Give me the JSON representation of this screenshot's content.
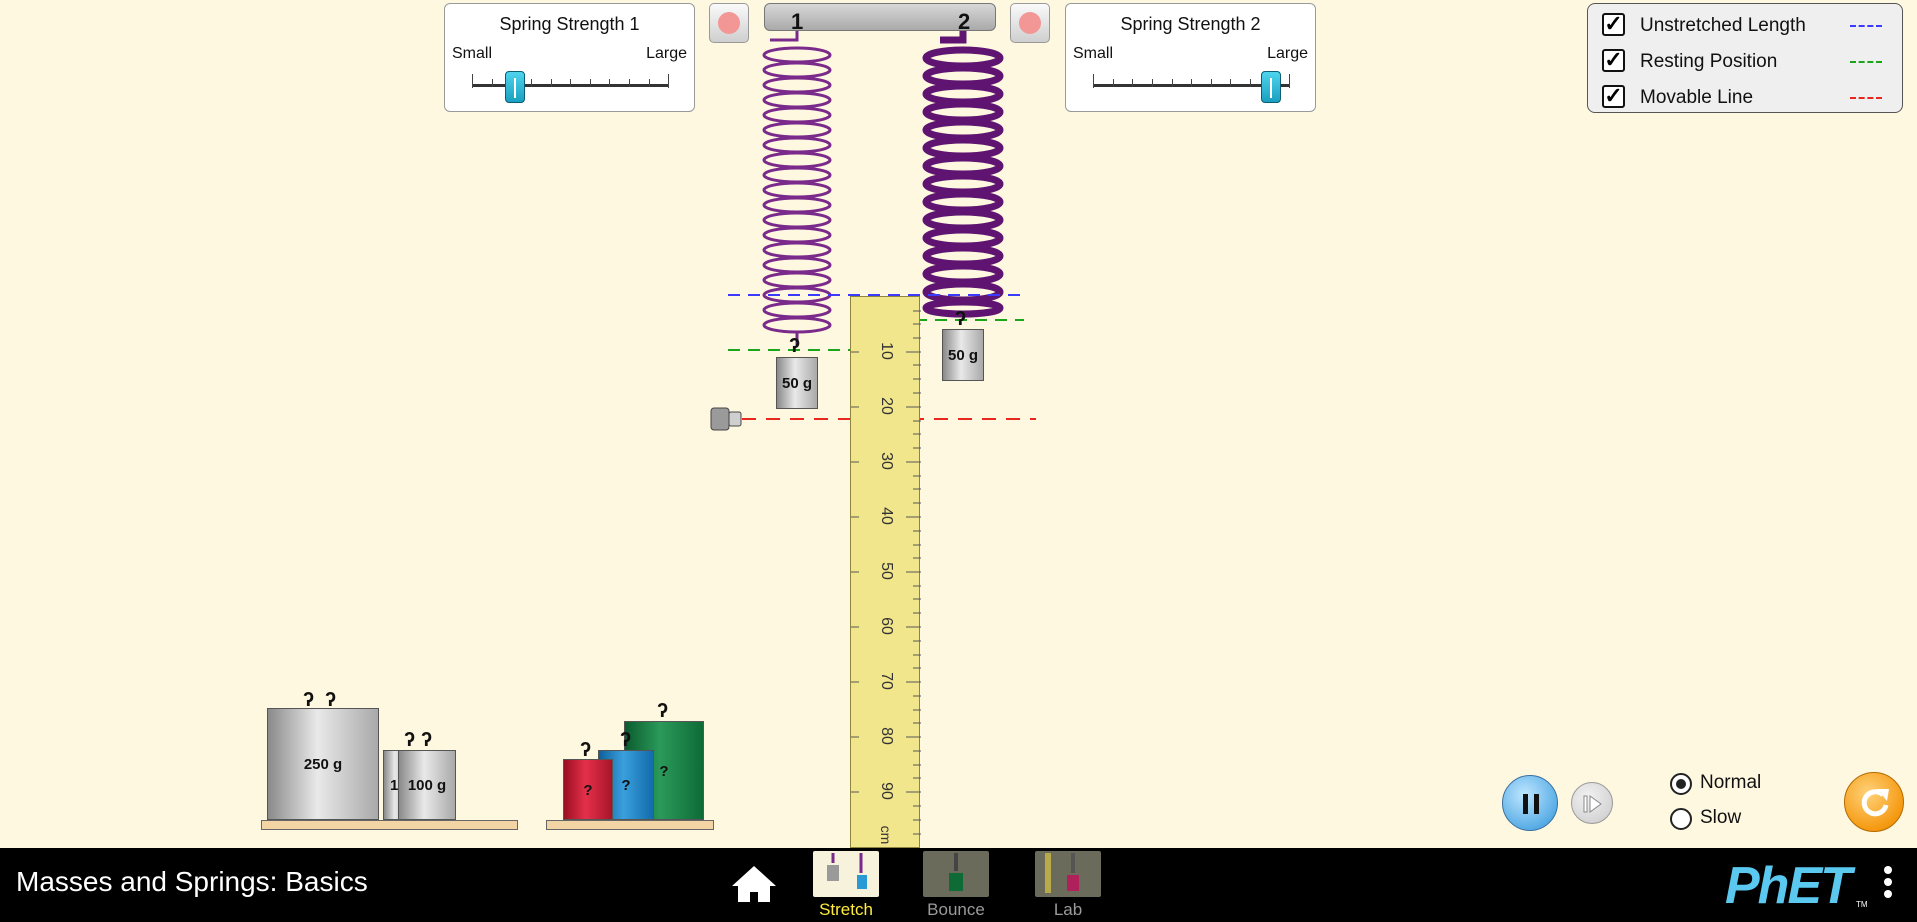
{
  "colors": {
    "background": "#fff8e1",
    "unstretched": "#3b3bff",
    "resting": "#1aa51a",
    "movable": "#e8271f",
    "spring": "#6e1a7e",
    "accent": "#1aa4c8"
  },
  "spring1": {
    "title": "Spring Strength 1",
    "small_label": "Small",
    "large_label": "Large",
    "level": 0.2
  },
  "spring2": {
    "title": "Spring Strength 2",
    "small_label": "Small",
    "large_label": "Large",
    "level": 0.9
  },
  "ceiling": {
    "label_1": "1",
    "label_2": "2"
  },
  "attached": {
    "mass1": "50 g",
    "mass2": "50 g"
  },
  "checkboxes": [
    {
      "label": "Unstretched Length",
      "checked": true
    },
    {
      "label": "Resting Position",
      "checked": true
    },
    {
      "label": "Movable Line",
      "checked": true
    }
  ],
  "ruler": {
    "numbers": [
      "10",
      "20",
      "30",
      "40",
      "50",
      "60",
      "70",
      "80",
      "90"
    ],
    "unit": "cm"
  },
  "shelf_masses": {
    "big": "250 g",
    "small": "100 g",
    "partial": "1",
    "unknown": "?"
  },
  "speed": {
    "normal": "Normal",
    "slow": "Slow",
    "selected": "Normal"
  },
  "navbar": {
    "title": "Masses and Springs: Basics",
    "tabs": [
      {
        "label": "Stretch",
        "active": true
      },
      {
        "label": "Bounce",
        "active": false
      },
      {
        "label": "Lab",
        "active": false
      }
    ],
    "logo": "PhET",
    "tm": "TM"
  },
  "icons": [
    "home-icon",
    "pause-icon",
    "step-icon",
    "reset-icon",
    "menu-icon"
  ]
}
